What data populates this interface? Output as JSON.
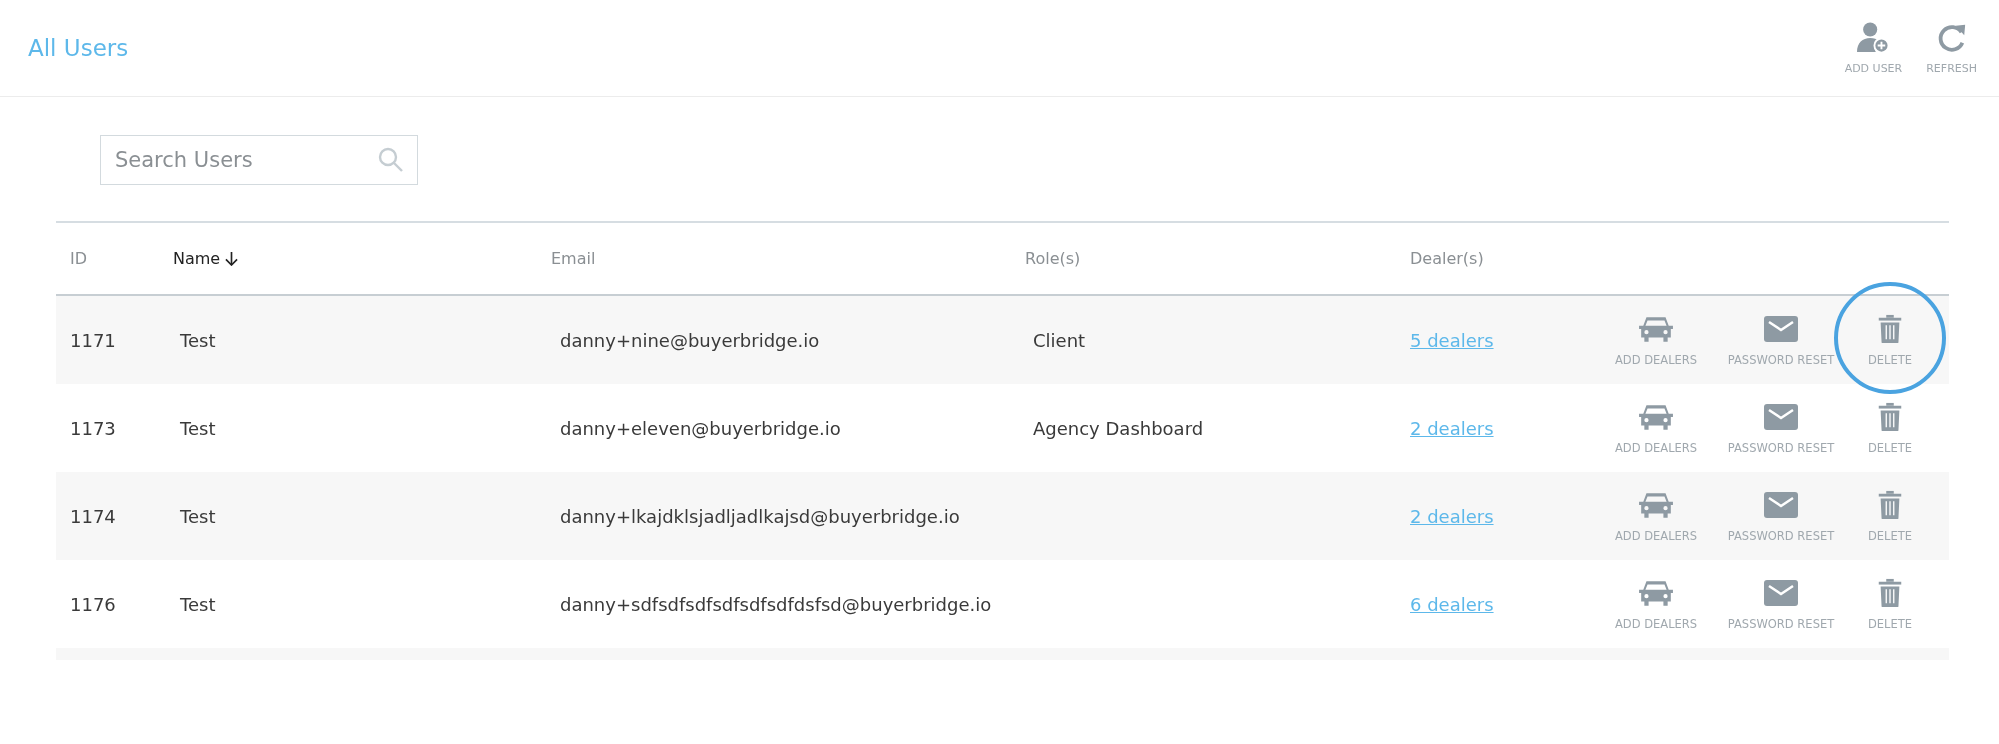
{
  "header": {
    "title": "All Users",
    "actions": [
      {
        "kind": "add-user",
        "label": "ADD USER"
      },
      {
        "kind": "refresh",
        "label": "REFRESH"
      }
    ]
  },
  "search": {
    "placeholder": "Search Users"
  },
  "table": {
    "columns": [
      {
        "label": "ID",
        "sorted": false
      },
      {
        "label": "Name",
        "sorted": true
      },
      {
        "label": "Email",
        "sorted": false
      },
      {
        "label": "Role(s)",
        "sorted": false
      },
      {
        "label": "Dealer(s)",
        "sorted": false
      }
    ],
    "rows": [
      {
        "id": "1171",
        "name": "Test",
        "email": "danny+nine@buyerbridge.io",
        "roles": "Client",
        "dealers": "5 dealers",
        "actions": [
          {
            "kind": "add-dealers",
            "label": "ADD DEALERS",
            "highlighted": false
          },
          {
            "kind": "password-reset",
            "label": "PASSWORD RESET",
            "highlighted": false
          },
          {
            "kind": "delete",
            "label": "DELETE",
            "highlighted": true
          }
        ]
      },
      {
        "id": "1173",
        "name": "Test",
        "email": "danny+eleven@buyerbridge.io",
        "roles": "Agency Dashboard",
        "dealers": "2 dealers",
        "actions": [
          {
            "kind": "add-dealers",
            "label": "ADD DEALERS",
            "highlighted": false
          },
          {
            "kind": "password-reset",
            "label": "PASSWORD RESET",
            "highlighted": false
          },
          {
            "kind": "delete",
            "label": "DELETE",
            "highlighted": false
          }
        ]
      },
      {
        "id": "1174",
        "name": "Test",
        "email": "danny+lkajdklsjadljadlkajsd@buyerbridge.io",
        "dealers": "2 dealers",
        "actions": [
          {
            "kind": "add-dealers",
            "label": "ADD DEALERS",
            "highlighted": false
          },
          {
            "kind": "password-reset",
            "label": "PASSWORD RESET",
            "highlighted": false
          },
          {
            "kind": "delete",
            "label": "DELETE",
            "highlighted": false
          }
        ]
      },
      {
        "id": "1176",
        "name": "Test",
        "email": "danny+sdfsdfsdfsdfsdfsdfdsfsd@buyerbridge.io",
        "dealers": "6 dealers",
        "actions": [
          {
            "kind": "add-dealers",
            "label": "ADD DEALERS",
            "highlighted": false
          },
          {
            "kind": "password-reset",
            "label": "PASSWORD RESET",
            "highlighted": false
          },
          {
            "kind": "delete",
            "label": "DELETE",
            "highlighted": false
          }
        ]
      }
    ]
  }
}
